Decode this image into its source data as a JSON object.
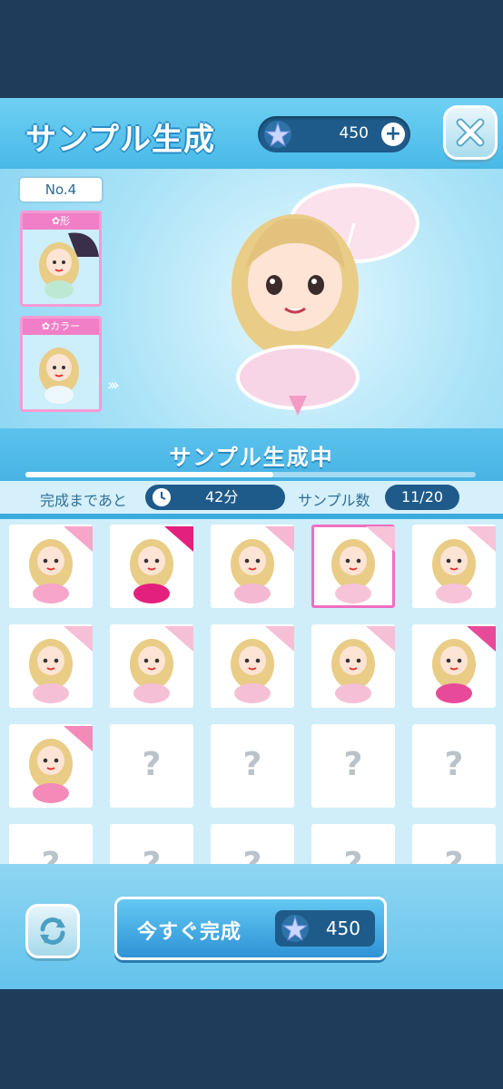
{
  "header": {
    "title": "サンプル生成",
    "currency_amount": "450",
    "currency_icon": "star-gem-icon",
    "plus_label": "+",
    "close_icon": "close-icon"
  },
  "preview": {
    "number_label": "No.4",
    "shape_tag": "形",
    "color_tag": "カラー",
    "arrows": "›››"
  },
  "progress": {
    "title": "サンプル生成中",
    "fraction": 0.55,
    "remaining_label": "完成まであと",
    "remaining_value": "42分",
    "sample_label": "サンプル数",
    "sample_value": "11/20"
  },
  "grid": {
    "unknown_mark": "?",
    "cells": [
      {
        "state": "done",
        "accent": "#f7a6c9"
      },
      {
        "state": "done",
        "accent": "#e4207d"
      },
      {
        "state": "done",
        "accent": "#f5b8d2"
      },
      {
        "state": "done",
        "accent": "#f7c3d9",
        "selected": true
      },
      {
        "state": "done",
        "accent": "#f7c3d9"
      },
      {
        "state": "done",
        "accent": "#f5c0d6"
      },
      {
        "state": "done",
        "accent": "#f5c0d6"
      },
      {
        "state": "done",
        "accent": "#f5c0d6"
      },
      {
        "state": "done",
        "accent": "#f5c0d6"
      },
      {
        "state": "done",
        "accent": "#e84a9a"
      },
      {
        "state": "done",
        "accent": "#f48ab8"
      },
      {
        "state": "unknown"
      },
      {
        "state": "unknown"
      },
      {
        "state": "unknown"
      },
      {
        "state": "unknown"
      },
      {
        "state": "unknown"
      },
      {
        "state": "unknown"
      },
      {
        "state": "unknown"
      },
      {
        "state": "unknown"
      },
      {
        "state": "unknown"
      }
    ]
  },
  "footer": {
    "complete_label": "今すぐ完成",
    "cost_value": "450"
  },
  "colors": {
    "accent_pink": "#ee6fc0",
    "navy": "#1e5b8a",
    "sky": "#48b9e8"
  }
}
